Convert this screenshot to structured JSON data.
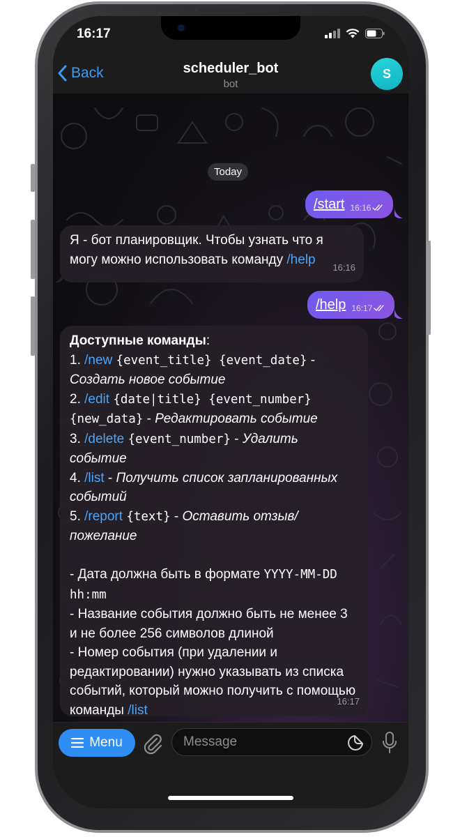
{
  "status_bar": {
    "time": "16:17"
  },
  "nav": {
    "back_label": "Back",
    "title": "scheduler_bot",
    "subtitle": "bot",
    "avatar_letter": "S"
  },
  "chat": {
    "date_label": "Today",
    "messages": [
      {
        "direction": "out",
        "text": "/start",
        "time": "16:16",
        "status": "read"
      },
      {
        "direction": "in",
        "time": "16:16",
        "text_a": "Я - бот планировщик. Чтобы узнать что я могу можно использовать команду ",
        "cmd": "/help"
      },
      {
        "direction": "out",
        "text": "/help",
        "time": "16:17",
        "status": "read"
      },
      {
        "direction": "in",
        "time": "16:17",
        "heading": "Доступные команды",
        "heading_colon": ":",
        "items": [
          {
            "num": "1. ",
            "cmd": "/new",
            "args": "{event_title} {event_date}",
            "dash": " - ",
            "desc": "Создать новое событие"
          },
          {
            "num": "2. ",
            "cmd": "/edit",
            "args": "{date|title} {event_number} {new_data}",
            "dash": " - ",
            "desc": "Редактировать событие"
          },
          {
            "num": "3. ",
            "cmd": "/delete",
            "args": "{event_number}",
            "dash": " - ",
            "desc": "Удалить событие"
          },
          {
            "num": "4. ",
            "cmd": "/list",
            "args": "",
            "dash": " - ",
            "desc": "Получить список запланированных событий"
          },
          {
            "num": "5. ",
            "cmd": "/report",
            "args": "{text}",
            "dash": " - ",
            "desc": "Оставить отзыв/пожелание"
          }
        ],
        "note1_prefix": "- Дата должна быть в формате ",
        "note1_format": "YYYY-MM-DD hh:mm",
        "note2": "- Название события должно быть не менее 3 и не более 256 символов длиной",
        "note3_prefix": "- Номер события (при удалении и редактировании) нужно указывать из списка событий, который можно получить с помощью команды ",
        "note3_cmd": "/list"
      }
    ]
  },
  "input_bar": {
    "menu_label": "Menu",
    "placeholder": "Message"
  },
  "colors": {
    "accent": "#2e8ef4",
    "link": "#4ea3f5",
    "outgoing_bubble": "#7a58ea",
    "avatar": "#1fc6d0"
  }
}
